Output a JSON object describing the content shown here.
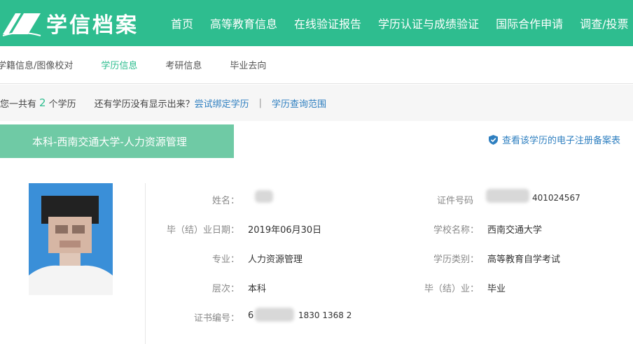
{
  "header": {
    "logo_text": "学信档案",
    "nav": [
      "首页",
      "高等教育信息",
      "在线验证报告",
      "学历认证与成绩验证",
      "国际合作申请",
      "调查/投票"
    ]
  },
  "subnav": {
    "items": [
      "学籍信息/图像校对",
      "学历信息",
      "考研信息",
      "毕业去向"
    ],
    "active": "学历信息"
  },
  "infobar": {
    "prefix": "您一共有",
    "count": "2",
    "suffix": "个学历",
    "question": "还有学历没有显示出来？",
    "bind_link": "尝试绑定学历",
    "separator": "|",
    "scope_link": "学历查询范围"
  },
  "record": {
    "tab_label": "本科-西南交通大学-人力资源管理",
    "registration_link": "查看该学历的电子注册备案表"
  },
  "fields": {
    "name_label": "姓名：",
    "cert_id_label": "证件号码",
    "cert_id_value": "401024567",
    "grad_date_label": "毕（结）业日期：",
    "grad_date_value": "2019年06月30日",
    "school_label": "学校名称：",
    "school_value": "西南交通大学",
    "major_label": "专业：",
    "major_value": "人力资源管理",
    "edu_type_label": "学历类别：",
    "edu_type_value": "高等教育自学考试",
    "level_label": "层次：",
    "level_value": "本科",
    "grad_status_label": "毕（结）业：",
    "grad_status_value": "毕业",
    "cert_no_label": "证书编号：",
    "cert_no_prefix": "6",
    "cert_no_suffix": "1830 1368 2"
  },
  "colors": {
    "brand_green": "#2ebd8f",
    "tab_green": "#6fcaa5",
    "link_blue": "#2e7fc0",
    "photo_bg": "#3a8fd8"
  }
}
